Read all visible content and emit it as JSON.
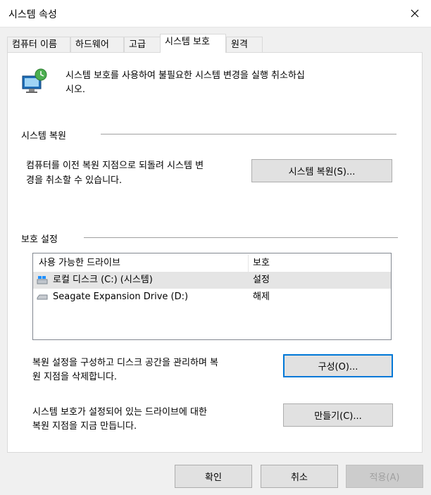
{
  "window": {
    "title": "시스템 속성"
  },
  "tabs": [
    {
      "label": "컴퓨터 이름"
    },
    {
      "label": "하드웨어"
    },
    {
      "label": "고급"
    },
    {
      "label": "시스템 보호"
    },
    {
      "label": "원격"
    }
  ],
  "active_tab": "시스템 보호",
  "intro": {
    "text1": "시스템 보호를 사용하여 불필요한 시스템 변경을 실행 취소하십",
    "text2": "시오."
  },
  "restore": {
    "section_label": "시스템 복원",
    "desc1": "컴퓨터를 이전 복원 지점으로 되돌려 시스템 변",
    "desc2": "경을 취소할 수 있습니다.",
    "button": "시스템 복원(S)..."
  },
  "protection": {
    "section_label": "보호 설정",
    "columns": [
      "사용 가능한 드라이브",
      "보호"
    ],
    "rows": [
      {
        "drive": "로컬 디스크 (C:) (시스템)",
        "status": "설정",
        "icon": "system-drive-icon"
      },
      {
        "drive": "Seagate Expansion Drive (D:)",
        "status": "해제",
        "icon": "external-drive-icon"
      }
    ],
    "configure_desc1": "복원 설정을 구성하고 디스크 공간을 관리하며 복",
    "configure_desc2": "원 지점을 삭제합니다.",
    "configure_button": "구성(O)...",
    "create_desc1": "시스템 보호가 설정되어 있는 드라이브에 대한",
    "create_desc2": "복원 지점을 지금 만듭니다.",
    "create_button": "만들기(C)..."
  },
  "footer": {
    "ok": "확인",
    "cancel": "취소",
    "apply": "적용(A)"
  },
  "colors": {
    "focus": "#0078d7",
    "selected_row": "#e5e5e5"
  }
}
